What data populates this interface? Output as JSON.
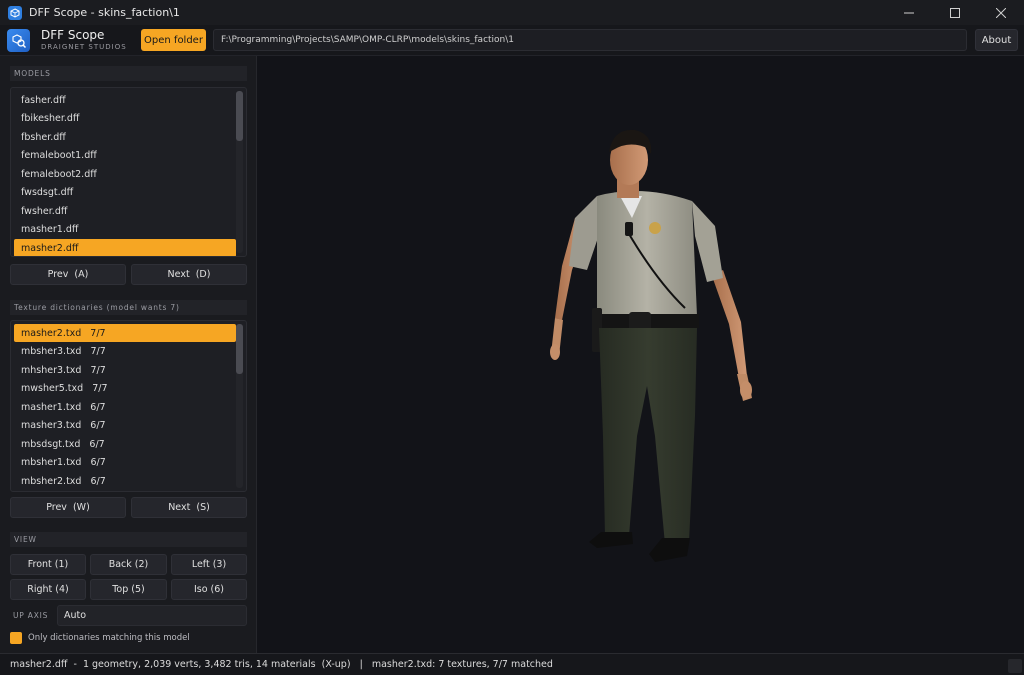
{
  "window": {
    "title": "DFF Scope  -  skins_faction\\1"
  },
  "header": {
    "brand_name": "DFF Scope",
    "brand_sub": "DRAIGNET STUDIOS",
    "open_label": "Open folder",
    "path": "F:\\Programming\\Projects\\SAMP\\OMP-CLRP\\models\\skins_faction\\1",
    "about_label": "About"
  },
  "models": {
    "label": "MODELS",
    "items": [
      "fasher.dff",
      "fbikesher.dff",
      "fbsher.dff",
      "femaleboot1.dff",
      "femaleboot2.dff",
      "fwsdsgt.dff",
      "fwsher.dff",
      "masher1.dff",
      "masher2.dff"
    ],
    "selected_index": 8,
    "prev_label": "Prev  (A)",
    "next_label": "Next  (D)"
  },
  "textures": {
    "label": "Texture dictionaries  (model wants 7)",
    "items": [
      "masher2.txd   7/7",
      "mbsher3.txd   7/7",
      "mhsher3.txd   7/7",
      "mwsher5.txd   7/7",
      "masher1.txd   6/7",
      "masher3.txd   6/7",
      "mbsdsgt.txd   6/7",
      "mbsher1.txd   6/7",
      "mbsher2.txd   6/7"
    ],
    "selected_index": 0,
    "prev_label": "Prev  (W)",
    "next_label": "Next  (S)"
  },
  "view": {
    "label": "VIEW",
    "buttons": [
      "Front (1)",
      "Back (2)",
      "Left (3)",
      "Right (4)",
      "Top (5)",
      "Iso (6)"
    ]
  },
  "up_axis": {
    "label": "UP AXIS",
    "value": "Auto"
  },
  "filter": {
    "label": "Only dictionaries matching this model",
    "checked": true
  },
  "status": {
    "text": "masher2.dff  -  1 geometry, 2,039 verts, 3,482 tris, 14 materials  (X-up)   |   masher2.txd: 7 textures, 7/7 matched"
  },
  "colors": {
    "accent": "#f6a623",
    "panel": "#1a1b1f",
    "viewport": "#121318"
  },
  "icons": {
    "app": "cube-icon",
    "logo": "magnifier-cube-icon"
  }
}
